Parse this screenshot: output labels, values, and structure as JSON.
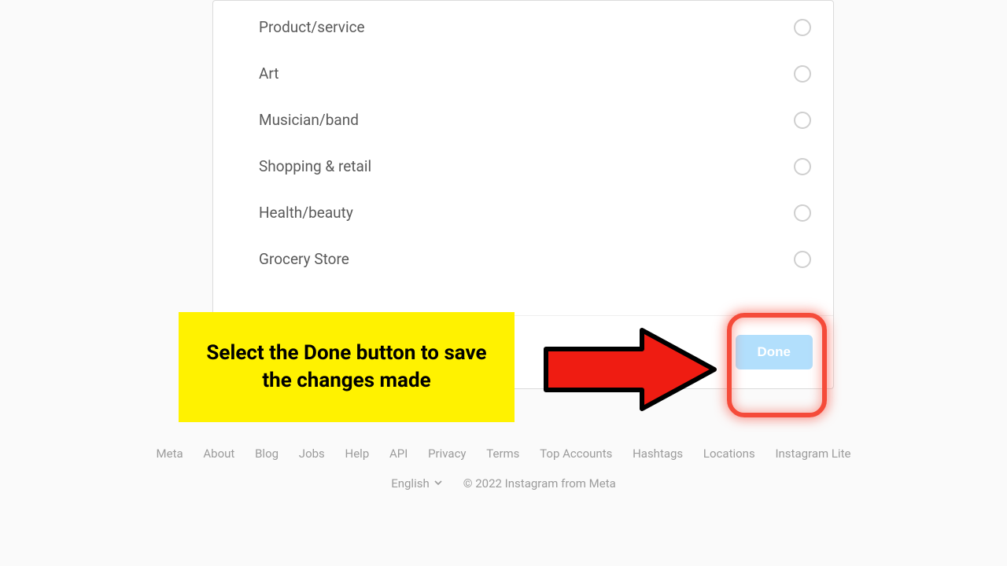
{
  "options": [
    {
      "label": "Product/service"
    },
    {
      "label": "Art"
    },
    {
      "label": "Musician/band"
    },
    {
      "label": "Shopping & retail"
    },
    {
      "label": "Health/beauty"
    },
    {
      "label": "Grocery Store"
    }
  ],
  "done_button": "Done",
  "callout": "Select the Done button to save the changes made",
  "footer_links": [
    "Meta",
    "About",
    "Blog",
    "Jobs",
    "Help",
    "API",
    "Privacy",
    "Terms",
    "Top Accounts",
    "Hashtags",
    "Locations",
    "Instagram Lite"
  ],
  "language": "English",
  "copyright": "© 2022 Instagram from Meta"
}
